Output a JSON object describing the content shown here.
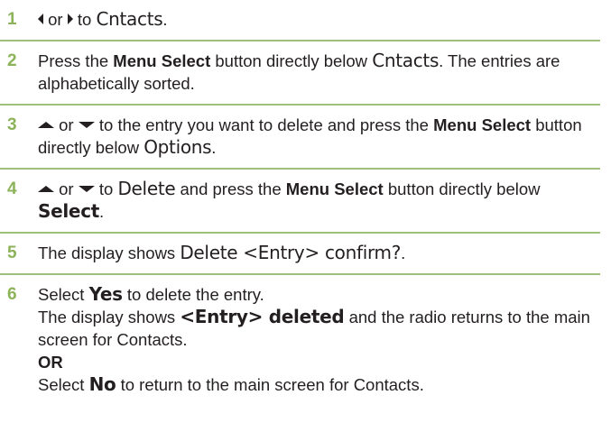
{
  "steps": [
    {
      "num": "1",
      "or": "or",
      "to": "to",
      "target": "Cntacts",
      "end": "."
    },
    {
      "num": "2",
      "a": "Press the",
      "btn": "Menu Select",
      "b": "button directly below",
      "target": "Cntacts",
      "c": ". The entries are alphabetically sorted."
    },
    {
      "num": "3",
      "or": "or",
      "a": "to the entry you want to delete and press the",
      "btn": "Menu Select",
      "b": "button directly below",
      "target": "Options",
      "end": "."
    },
    {
      "num": "4",
      "or": "or",
      "a": "to",
      "target1": "Delete",
      "b": "and press the",
      "btn": "Menu Select",
      "c": "button directly below",
      "target2": "Select",
      "end": "."
    },
    {
      "num": "5",
      "a": "The display shows",
      "display": "Delete <Entry> confirm?",
      "end": "."
    },
    {
      "num": "6",
      "a": "Select",
      "yes": "Yes",
      "b": "to delete the entry.",
      "c": "The display shows",
      "display": "<Entry> deleted",
      "d": "and the radio returns to the main screen for Contacts.",
      "or_label": "OR",
      "e": "Select",
      "no": "No",
      "f": "to return to the main screen for Contacts."
    }
  ],
  "icons": {
    "left": "left-arrow-icon",
    "right": "right-arrow-icon",
    "up": "up-arrow-icon",
    "down": "down-arrow-icon"
  }
}
